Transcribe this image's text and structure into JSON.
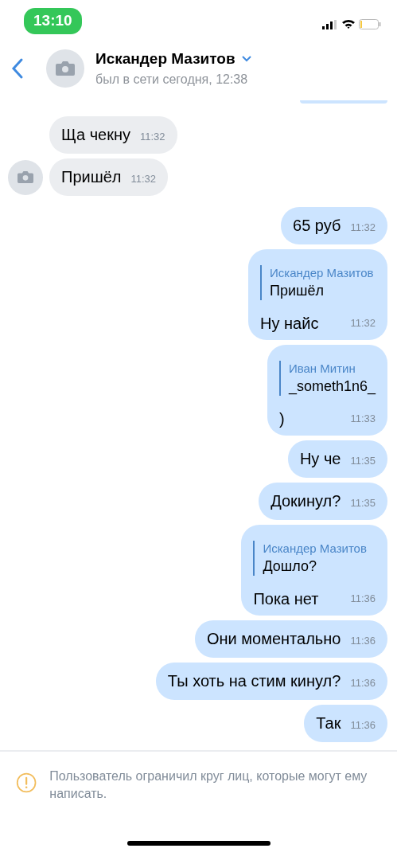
{
  "status_bar": {
    "time": "13:10"
  },
  "header": {
    "name": "Искандер Мазитов",
    "status": "был в сети сегодня, 12:38"
  },
  "messages": [
    {
      "outgoing": false,
      "avatar": false,
      "text": "Ща чекну",
      "time": "11:32"
    },
    {
      "outgoing": false,
      "avatar": true,
      "text": "Пришёл",
      "time": "11:32"
    },
    {
      "outgoing": true,
      "text": "65 руб",
      "time": "11:32"
    },
    {
      "outgoing": true,
      "reply": {
        "author": "Искандер Мазитов",
        "text": "Пришёл"
      },
      "text": "Ну найс",
      "time": "11:32"
    },
    {
      "outgoing": true,
      "reply": {
        "author": "Иван Митин",
        "text": "_someth1n6_"
      },
      "text": ")",
      "time": "11:33"
    },
    {
      "outgoing": true,
      "text": "Ну че",
      "time": "11:35"
    },
    {
      "outgoing": true,
      "text": "Докинул?",
      "time": "11:35"
    },
    {
      "outgoing": true,
      "reply": {
        "author": "Искандер Мазитов",
        "text": "Дошло?"
      },
      "text": "Пока нет",
      "time": "11:36"
    },
    {
      "outgoing": true,
      "text": "Они моментально",
      "time": "11:36"
    },
    {
      "outgoing": true,
      "text": "Ты хоть на стим кинул?",
      "time": "11:36"
    },
    {
      "outgoing": true,
      "text": "Так",
      "time": "11:36"
    }
  ],
  "notice": "Пользователь ограничил круг лиц, которые могут ему написать."
}
